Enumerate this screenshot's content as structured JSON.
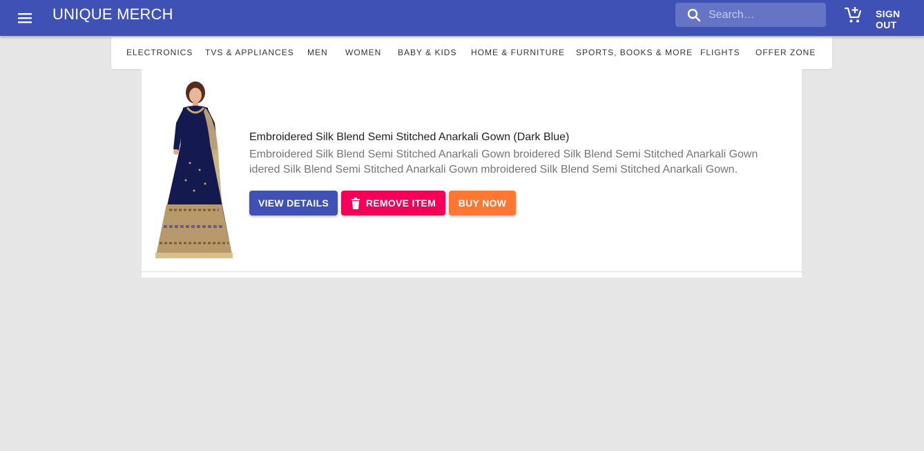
{
  "header": {
    "brand": "UNIQUE MERCH",
    "search_placeholder": "Search…",
    "sign_out_label": "SIGN OUT",
    "color": "#3f51b5"
  },
  "categories": [
    "ELECTRONICS",
    "TVS & APPLIANCES",
    "MEN",
    "WOMEN",
    "BABY & KIDS",
    "HOME & FURNITURE",
    "SPORTS, BOOKS & MORE",
    "FLIGHTS",
    "OFFER ZONE"
  ],
  "item": {
    "title": "Embroidered Silk Blend Semi Stitched Anarkali Gown (Dark Blue)",
    "description": "Embroidered Silk Blend Semi Stitched Anarkali Gown broidered Silk Blend Semi Stitched Anarkali Gown idered Silk Blend Semi Stitched Anarkali Gown mbroidered Silk Blend Semi Stitched Anarkali Gown.",
    "image_icon": "anarkali-gown-image",
    "actions": {
      "view_details": "VIEW DETAILS",
      "remove_item": "REMOVE ITEM",
      "buy_now": "BUY NOW"
    }
  },
  "colors": {
    "primary": "#3f51b5",
    "remove": "#f50057",
    "buy": "#ff7733"
  }
}
